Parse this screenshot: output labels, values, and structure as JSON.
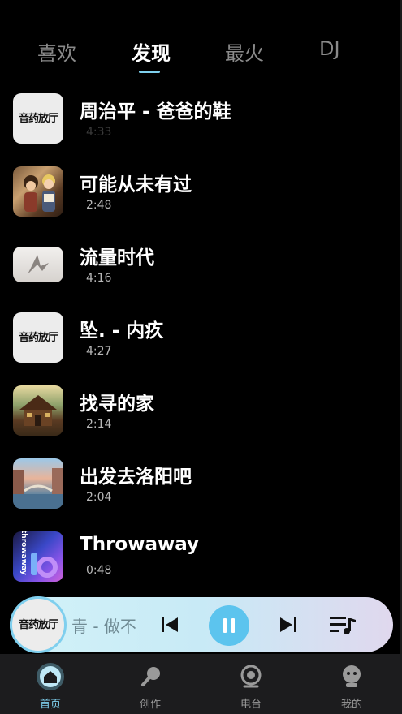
{
  "tabs": [
    {
      "label": "喜欢",
      "active": false
    },
    {
      "label": "发现",
      "active": true
    },
    {
      "label": "最火",
      "active": false
    },
    {
      "label": "DJ",
      "active": false
    }
  ],
  "songs": [
    {
      "title": "周治平 - 爸爸的鞋",
      "duration": "4:33",
      "cover": "音药放厅"
    },
    {
      "title": "可能从未有过",
      "duration": "2:48",
      "cover": ""
    },
    {
      "title": "流量时代",
      "duration": "4:16",
      "cover": ""
    },
    {
      "title": "坠. - 内疚",
      "duration": "4:27",
      "cover": "音药放厅"
    },
    {
      "title": "找寻的家",
      "duration": "2:14",
      "cover": ""
    },
    {
      "title": "出发去洛阳吧",
      "duration": "2:04",
      "cover": ""
    },
    {
      "title": "Throwaway",
      "duration": "0:48",
      "cover": "throwaway"
    }
  ],
  "player": {
    "disc_label": "音药放厅",
    "now_playing": "青 - 做不",
    "state": "playing"
  },
  "nav": [
    {
      "label": "首页",
      "icon": "home-icon",
      "active": true
    },
    {
      "label": "创作",
      "icon": "microphone-icon",
      "active": false
    },
    {
      "label": "电台",
      "icon": "radio-icon",
      "active": false
    },
    {
      "label": "我的",
      "icon": "profile-icon",
      "active": false
    }
  ],
  "colors": {
    "accent": "#7fd0ee",
    "play_button": "#5cc4ee",
    "background": "#000000",
    "nav_background": "#1c1c1e"
  }
}
